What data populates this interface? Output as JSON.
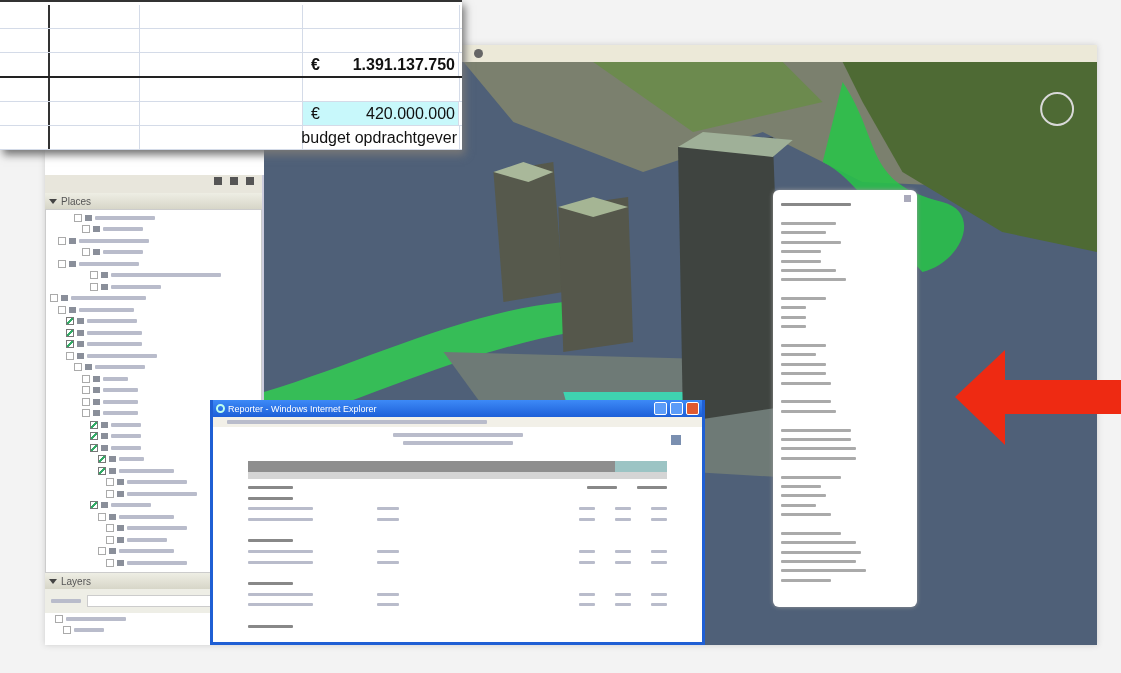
{
  "spreadsheet": {
    "total": {
      "currency": "€",
      "amount": "1.391.137.750"
    },
    "budget": {
      "currency": "€",
      "amount": "420.000.000",
      "highlighted": true
    },
    "budget_label": "budget opdrachtgever"
  },
  "sidebar": {
    "places_title": "Places",
    "layers_title": "Layers",
    "tree": [
      {
        "checked": false
      },
      {
        "checked": false
      },
      {
        "checked": false
      },
      {
        "checked": false
      },
      {
        "checked": false
      },
      {
        "checked": false
      },
      {
        "checked": false
      },
      {
        "checked": false
      },
      {
        "checked": false
      },
      {
        "checked": true
      },
      {
        "checked": true
      },
      {
        "checked": true
      },
      {
        "checked": false
      },
      {
        "checked": false
      },
      {
        "checked": false
      },
      {
        "checked": false
      },
      {
        "checked": false
      },
      {
        "checked": false
      },
      {
        "checked": true
      },
      {
        "checked": true
      },
      {
        "checked": true
      },
      {
        "checked": true
      },
      {
        "checked": true
      },
      {
        "checked": false
      },
      {
        "checked": false
      },
      {
        "checked": true
      },
      {
        "checked": false
      },
      {
        "checked": false
      },
      {
        "checked": false
      },
      {
        "checked": false
      },
      {
        "checked": false
      }
    ],
    "layers": [
      {
        "checked": false
      },
      {
        "checked": false
      }
    ]
  },
  "reporter_window": {
    "title": "Reporter - Windows Internet Explorer"
  }
}
